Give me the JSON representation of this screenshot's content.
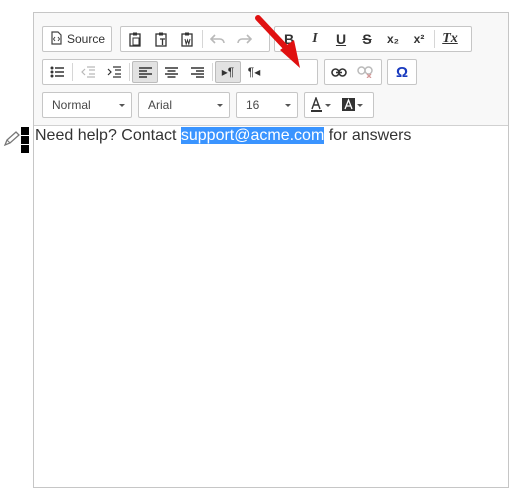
{
  "toolbar": {
    "source_label": "Source",
    "format_value": "Normal",
    "font_value": "Arial",
    "size_value": "16",
    "icons": {
      "bold": "B",
      "italic": "I",
      "underline": "U",
      "strike": "S",
      "subscript": "x₂",
      "superscript": "x²",
      "remove_format": "Tx",
      "special_char": "Ω",
      "ltr": "▸¶",
      "rtl": "¶◂"
    }
  },
  "content": {
    "text_before": "Need help? Contact ",
    "selected_text": "support@acme.com",
    "text_after": " for answers"
  },
  "colors": {
    "selection": "#3a94ff",
    "annotation_arrow": "#e01010",
    "special_char": "#1a3bbf"
  }
}
